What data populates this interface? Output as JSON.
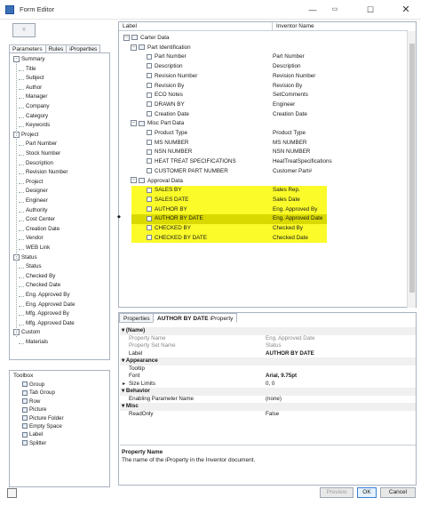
{
  "window": {
    "title": "Form Editor"
  },
  "left_tabs": [
    "Parameters",
    "Rules",
    "iProperties"
  ],
  "left_tree": [
    {
      "label": "Summary",
      "level": 0,
      "expander": "-"
    },
    {
      "label": "Title",
      "level": 1
    },
    {
      "label": "Subject",
      "level": 1
    },
    {
      "label": "Author",
      "level": 1
    },
    {
      "label": "Manager",
      "level": 1
    },
    {
      "label": "Company",
      "level": 1
    },
    {
      "label": "Category",
      "level": 1
    },
    {
      "label": "Keywords",
      "level": 1
    },
    {
      "label": "Project",
      "level": 0,
      "expander": "-"
    },
    {
      "label": "Part Number",
      "level": 1
    },
    {
      "label": "Stock Number",
      "level": 1
    },
    {
      "label": "Description",
      "level": 1
    },
    {
      "label": "Revision Number",
      "level": 1
    },
    {
      "label": "Project",
      "level": 1
    },
    {
      "label": "Designer",
      "level": 1
    },
    {
      "label": "Engineer",
      "level": 1
    },
    {
      "label": "Authority",
      "level": 1
    },
    {
      "label": "Cost Center",
      "level": 1
    },
    {
      "label": "Creation Date",
      "level": 1
    },
    {
      "label": "Vendor",
      "level": 1
    },
    {
      "label": "WEB Link",
      "level": 1
    },
    {
      "label": "Status",
      "level": 0,
      "expander": "-"
    },
    {
      "label": "Status",
      "level": 1
    },
    {
      "label": "Checked By",
      "level": 1
    },
    {
      "label": "Checked Date",
      "level": 1
    },
    {
      "label": "Eng. Approved By",
      "level": 1
    },
    {
      "label": "Eng. Approved Date",
      "level": 1
    },
    {
      "label": "Mfg. Approved By",
      "level": 1
    },
    {
      "label": "Mfg. Approved Date",
      "level": 1
    },
    {
      "label": "Custom",
      "level": 0,
      "expander": "-"
    },
    {
      "label": "Materials",
      "level": 1
    }
  ],
  "toolbox": {
    "title": "Toolbox",
    "items": [
      "Group",
      "Tab Group",
      "Row",
      "Picture",
      "Picture Folder",
      "Empty Space",
      "Label",
      "Splitter"
    ]
  },
  "form_tree": {
    "columns": [
      "Label",
      "Inventor Name"
    ],
    "rows": [
      {
        "label": "Carter Data",
        "value": "",
        "level": 0,
        "kind": "group"
      },
      {
        "label": "Part Identification",
        "value": "",
        "level": 1,
        "kind": "group"
      },
      {
        "label": "Part Number",
        "value": "Part Number",
        "level": 2,
        "kind": "ctrl"
      },
      {
        "label": "Description",
        "value": "Description",
        "level": 2,
        "kind": "ctrl"
      },
      {
        "label": "Revision Number",
        "value": "Revision Number",
        "level": 2,
        "kind": "ctrl"
      },
      {
        "label": "Revision By",
        "value": "Revision By",
        "level": 2,
        "kind": "ctrl"
      },
      {
        "label": "ECO Notes",
        "value": "SetComments",
        "level": 2,
        "kind": "ctrl"
      },
      {
        "label": "DRAWN BY",
        "value": "Engineer",
        "level": 2,
        "kind": "ctrl"
      },
      {
        "label": "Creation Date",
        "value": "Creation Date",
        "level": 2,
        "kind": "ctrl"
      },
      {
        "label": "Misc Part Data",
        "value": "",
        "level": 1,
        "kind": "group"
      },
      {
        "label": "Product Type",
        "value": "Product Type",
        "level": 2,
        "kind": "ctrl"
      },
      {
        "label": "MS NUMBER",
        "value": "MS NUMBER",
        "level": 2,
        "kind": "ctrl"
      },
      {
        "label": "NSN NUMBER",
        "value": "NSN NUMBER",
        "level": 2,
        "kind": "ctrl"
      },
      {
        "label": "HEAT TREAT SPECIFICATIONS",
        "value": "HeatTreatSpecifications",
        "level": 2,
        "kind": "ctrl"
      },
      {
        "label": "CUSTOMER PART NUMBER",
        "value": "Customer Part#",
        "level": 2,
        "kind": "ctrl"
      },
      {
        "label": "Approval Data",
        "value": "",
        "level": 1,
        "kind": "group"
      },
      {
        "label": "SALES BY",
        "value": "Sales Rep.",
        "level": 2,
        "kind": "ctrl",
        "highlight": true
      },
      {
        "label": "SALES DATE",
        "value": "Sales Date",
        "level": 2,
        "kind": "ctrl",
        "highlight": true
      },
      {
        "label": "AUTHOR BY",
        "value": "Eng. Approved By",
        "level": 2,
        "kind": "ctrl",
        "highlight": true
      },
      {
        "label": "AUTHOR BY DATE",
        "value": "Eng. Approved Date",
        "level": 2,
        "kind": "ctrl",
        "highlight": true,
        "selected": true
      },
      {
        "label": "CHECKED BY",
        "value": "Checked By",
        "level": 2,
        "kind": "ctrl",
        "highlight": true
      },
      {
        "label": "CHECKED BY DATE",
        "value": "Checked Date",
        "level": 2,
        "kind": "ctrl",
        "highlight": true
      }
    ]
  },
  "properties": {
    "tab_properties": "Properties",
    "tab_selected_title": "AUTHOR BY DATE",
    "tab_selected_suffix": "iProperty",
    "rows": [
      {
        "type": "cat",
        "label": "(Name)"
      },
      {
        "type": "prop",
        "name": "Property Name",
        "value": "Eng. Approved Date",
        "grey": true
      },
      {
        "type": "prop",
        "name": "Property Set Name",
        "value": "Status",
        "grey": true
      },
      {
        "type": "prop",
        "name": "Label",
        "value": "AUTHOR BY DATE",
        "bold": true
      },
      {
        "type": "cat",
        "label": "Appearance"
      },
      {
        "type": "prop",
        "name": "Tooltip",
        "value": ""
      },
      {
        "type": "prop",
        "name": "Font",
        "value": "Arial, 9.75pt",
        "bold": true
      },
      {
        "type": "prop",
        "name": "Size Limits",
        "value": "0, 0",
        "expander": true
      },
      {
        "type": "cat",
        "label": "Behavior"
      },
      {
        "type": "prop",
        "name": "Enabling Parameter Name",
        "value": "(none)"
      },
      {
        "type": "cat",
        "label": "Misc"
      },
      {
        "type": "prop",
        "name": "ReadOnly",
        "value": "False"
      }
    ],
    "description_title": "Property Name",
    "description_text": "The name of the iProperty in the Inventor document."
  },
  "buttons": {
    "preview": "Preview",
    "ok": "OK",
    "cancel": "Cancel"
  },
  "colors": {
    "highlight": "#fbfb2a",
    "selected_highlight": "#d9d900",
    "accent": "#3c7fd8"
  }
}
